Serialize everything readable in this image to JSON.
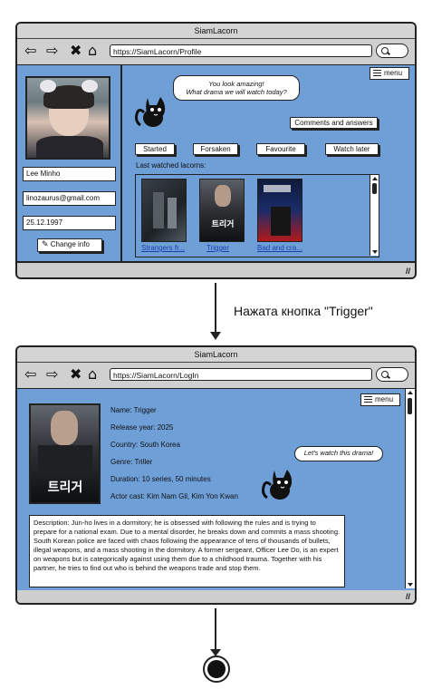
{
  "screen1": {
    "title": "SiamLacorn",
    "url": "https://SiamLacorn/Profile",
    "menu_label": "menu",
    "bubble_line1": "You look amazing!",
    "bubble_line2": "What drama we will watch today?",
    "comments_button": "Comments and answers",
    "name": "Lee Minho",
    "email": "linozaurus@gmail.com",
    "birthdate": "25.12.1997",
    "change_info_button": "Change info",
    "tabs": [
      "Started",
      "Forsaken",
      "Favourite",
      "Watch later"
    ],
    "last_watched_label": "Last watched lacorns:",
    "posters": [
      {
        "title": "Strangers fr..."
      },
      {
        "title": "Trigger"
      },
      {
        "title": "Bad and cra..."
      }
    ]
  },
  "transition_label": "Нажата кнопка \"Trigger\"",
  "screen2": {
    "title": "SiamLacorn",
    "url": "https://SiamLacorn/LogIn",
    "menu_label": "menu",
    "bubble": "Let's watch this drama!",
    "details": {
      "name": "Name: Trigger",
      "release_year": "Release year: 2025",
      "country": "Country: South Korea",
      "genre": "Genre: Triller",
      "duration": "Duration: 10 series, 50 minutes",
      "cast": "Actor cast: Kim Nam Gil, Kim Yon Kwan"
    },
    "description": "Description: Jun-ho lives in a dormitory; he is obsessed with following the rules and is trying to prepare for a national exam. Due to a mental disorder, he breaks down and commits a mass shooting. South Korean police are faced with chaos following the appearance of tens of thousands of bullets, illegal weapons, and a mass shooting in the dormitory. A former sergeant, Officer Lee Do, is an expert on weapons but is categorically against using them due to a childhood trauma. Together with his partner, he tries to find out who is behind the weapons trade and stop them."
  }
}
